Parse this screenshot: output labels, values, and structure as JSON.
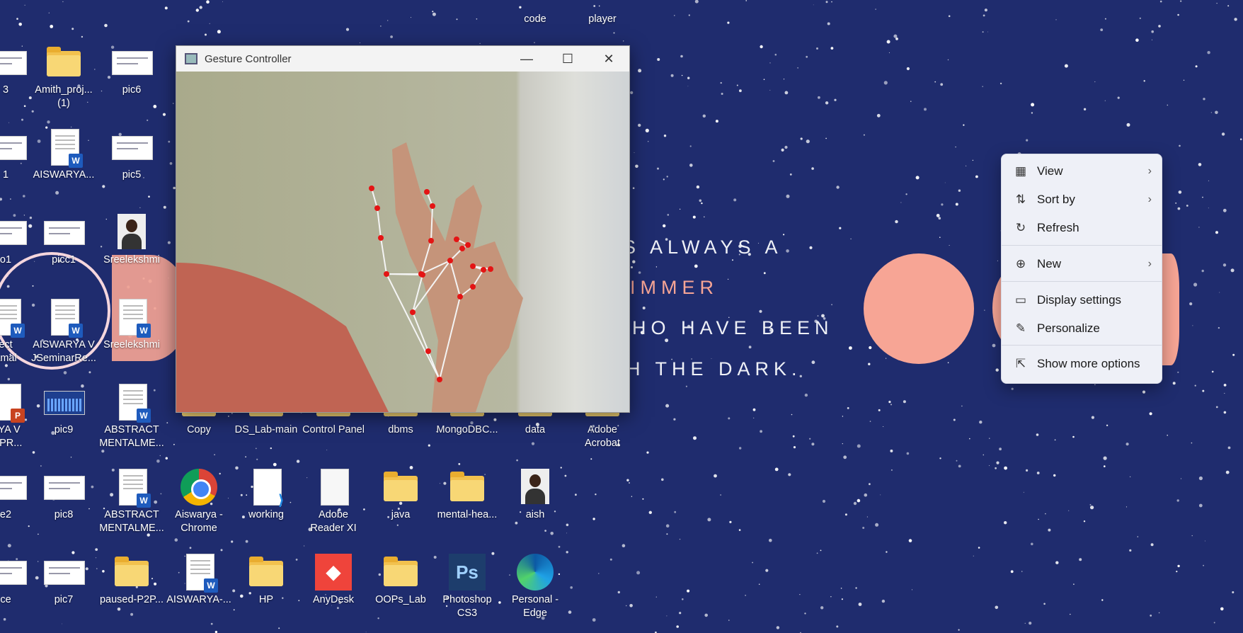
{
  "wallpaper": {
    "quote_lines": [
      "S ALWAYS A",
      "IMMER",
      "HO HAVE BEEN",
      "H THE DARK."
    ]
  },
  "desktop_icons": [
    {
      "label": "3",
      "kind": "thumb"
    },
    {
      "label": "Amith_proj...\n(1)",
      "kind": "folder"
    },
    {
      "label": "pic6",
      "kind": "thumb"
    },
    {
      "label": "1",
      "kind": "thumb"
    },
    {
      "label": "AISWARYA...",
      "kind": "word"
    },
    {
      "label": "pic5",
      "kind": "thumb"
    },
    {
      "label": "o1",
      "kind": "thumb"
    },
    {
      "label": "picc1",
      "kind": "thumb"
    },
    {
      "label": "Sreelekshmi",
      "kind": "photo"
    },
    {
      "label": "ect\namal",
      "kind": "word"
    },
    {
      "label": "AISWARYA V\nJSeminarRe...",
      "kind": "word"
    },
    {
      "label": "Sreelekshmi",
      "kind": "word"
    },
    {
      "label": "RYA V\nN PR...",
      "kind": "ppt"
    },
    {
      "label": "pic9",
      "kind": "chart"
    },
    {
      "label": "ABSTRACT\nMENTALME...",
      "kind": "word"
    },
    {
      "label": "Copy",
      "kind": "folder"
    },
    {
      "label": "DS_Lab-main",
      "kind": "folder"
    },
    {
      "label": "Control Panel",
      "kind": "control"
    },
    {
      "label": "dbms",
      "kind": "folder"
    },
    {
      "label": "MongoDBC...",
      "kind": "folder"
    },
    {
      "label": "data",
      "kind": "folder"
    },
    {
      "label": "Adobe\nAcrobat",
      "kind": "acrobat"
    },
    {
      "label": "e2",
      "kind": "thumb"
    },
    {
      "label": "pic8",
      "kind": "thumb"
    },
    {
      "label": "ABSTRACT\nMENTALME...",
      "kind": "word"
    },
    {
      "label": "Aiswarya -\nChrome",
      "kind": "chrome"
    },
    {
      "label": "working",
      "kind": "code"
    },
    {
      "label": "Adobe\nReader XI",
      "kind": "blankdoc"
    },
    {
      "label": "java",
      "kind": "folder"
    },
    {
      "label": "mental-hea...",
      "kind": "folder"
    },
    {
      "label": "aish",
      "kind": "photo"
    },
    {
      "label": "ce",
      "kind": "thumb"
    },
    {
      "label": "pic7",
      "kind": "thumb"
    },
    {
      "label": "paused-P2P...",
      "kind": "folder"
    },
    {
      "label": "AISWARYA-...",
      "kind": "word"
    },
    {
      "label": "HP",
      "kind": "folder"
    },
    {
      "label": "AnyDesk",
      "kind": "anydesk"
    },
    {
      "label": "OOPs_Lab",
      "kind": "folder"
    },
    {
      "label": "Photoshop\nCS3",
      "kind": "photoshop"
    },
    {
      "label": "Personal -\nEdge",
      "kind": "edge"
    },
    {
      "label": "code",
      "kind": "partial"
    },
    {
      "label": "player",
      "kind": "partial"
    }
  ],
  "window": {
    "title": "Gesture Controller",
    "minimize": "—",
    "maximize": "☐",
    "close": "✕"
  },
  "context_menu": {
    "items": [
      {
        "label": "View",
        "icon": "grid-icon",
        "submenu": true
      },
      {
        "label": "Sort by",
        "icon": "sort-icon",
        "submenu": true
      },
      {
        "label": "Refresh",
        "icon": "refresh-icon",
        "submenu": false
      },
      {
        "label": "New",
        "icon": "plus-circle-icon",
        "submenu": true
      },
      {
        "label": "Display settings",
        "icon": "display-icon",
        "submenu": false
      },
      {
        "label": "Personalize",
        "icon": "brush-icon",
        "submenu": false
      },
      {
        "label": "Show more options",
        "icon": "share-icon",
        "submenu": false
      }
    ]
  },
  "colors": {
    "wallpaper": "#1f2c6e",
    "accent_pink": "#f7a595",
    "landmark": "#e41414"
  }
}
